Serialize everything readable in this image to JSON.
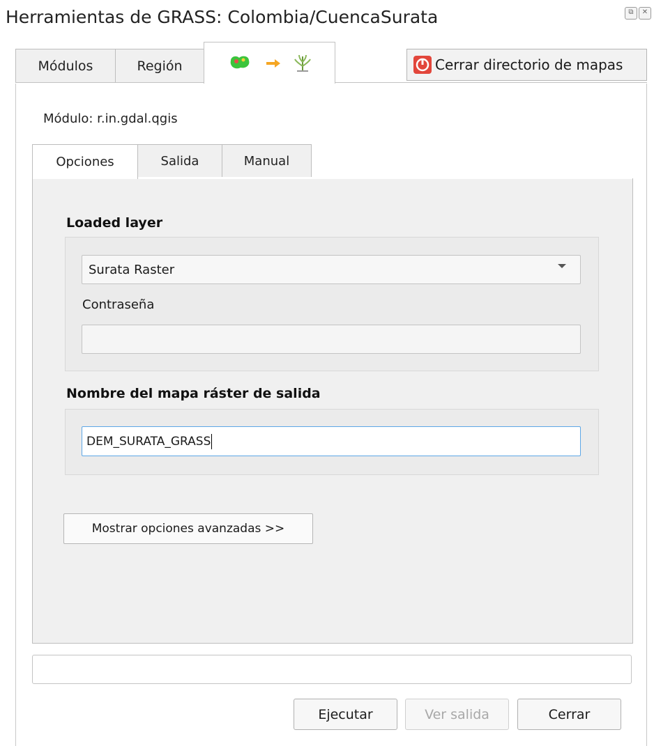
{
  "window": {
    "title": "Herramientas de GRASS: Colombia/CuencaSurata"
  },
  "title_controls": [
    {
      "icon": "float-icon",
      "glyph": "⧉"
    },
    {
      "icon": "close-icon",
      "glyph": "✕"
    }
  ],
  "top_tabs": {
    "modules": "Módulos",
    "region": "Región",
    "third_tab_icons": [
      "raster-icon",
      "arrow-right-icon",
      "grass-icon"
    ]
  },
  "close_mapset_label": "Cerrar directorio de mapas",
  "module": {
    "label": "Módulo: r.in.gdal.qgis"
  },
  "inner_tabs": {
    "options": "Opciones",
    "output": "Salida",
    "manual": "Manual"
  },
  "form": {
    "loaded_layer": {
      "title": "Loaded layer",
      "selected": "Surata Raster",
      "password_label": "Contraseña",
      "password_value": ""
    },
    "output_map": {
      "title": "Nombre del mapa ráster de salida",
      "value": "DEM_SURATA_GRASS"
    },
    "advanced_button": "Mostrar opciones avanzadas >>"
  },
  "status_text": "",
  "buttons": {
    "run": "Ejecutar",
    "view_output": "Ver salida",
    "close": "Cerrar"
  },
  "colors": {
    "focus_border": "#5ca6e6",
    "close_icon_red": "#e2463b",
    "raster_green": "#3cc43c",
    "arrow_orange": "#f5a623"
  }
}
